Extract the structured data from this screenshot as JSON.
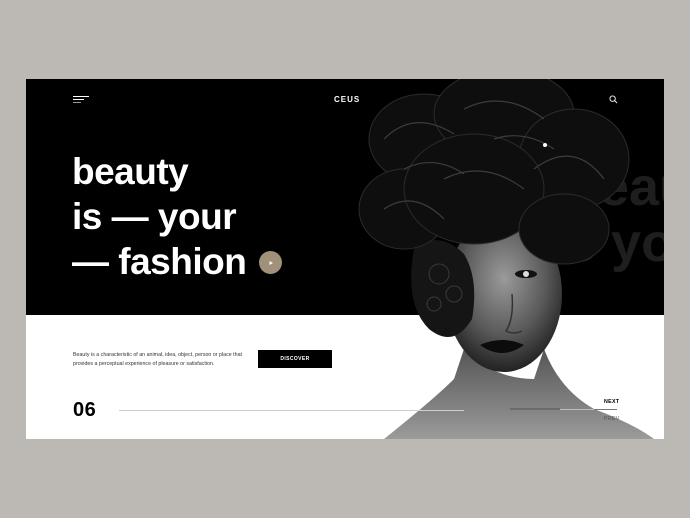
{
  "brand": "CEUS",
  "headline": {
    "line1": "beauty",
    "line2": "is — your",
    "line3": "— fashion"
  },
  "ghost_text": {
    "line1": "beau",
    "line2": "s yo"
  },
  "description": "Beauty is a characteristic of an animal, idea, object, person or place that provides a perceptual experience of pleasure or satisfaction.",
  "discover_label": "DISCOVER",
  "slide_number": "06",
  "nav": {
    "next": "NEXT",
    "prev": "PREV"
  },
  "icons": {
    "menu": "hamburger-icon",
    "search": "search-icon",
    "play": "play-icon"
  },
  "colors": {
    "background": "#bcb8b3",
    "hero": "#000000",
    "accent": "#a1907a",
    "button": "#000000"
  }
}
